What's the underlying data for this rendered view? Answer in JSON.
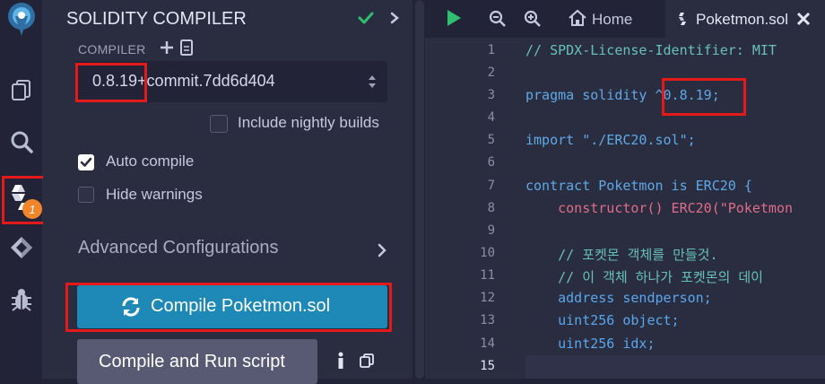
{
  "panel": {
    "title": "SOLIDITY COMPILER",
    "compiler_label": "COMPILER",
    "compiler_version": "0.8.19+commit.7dd6d404",
    "nightly_label": "Include nightly builds",
    "auto_compile_label": "Auto compile",
    "hide_warnings_label": "Hide warnings",
    "advanced_label": "Advanced Configurations",
    "compile_button": "Compile Poketmon.sol",
    "compile_run_button": "Compile and Run script",
    "auto_compile_checked": true,
    "hide_warnings_checked": false,
    "nightly_checked": false
  },
  "iconbar": {
    "badge": "1"
  },
  "editor": {
    "tab_home": "Home",
    "tab_active": "Poketmon.sol",
    "line_numbers": [
      "1",
      "2",
      "3",
      "4",
      "5",
      "6",
      "7",
      "8",
      "9",
      "10",
      "11",
      "12",
      "13",
      "14",
      "15"
    ],
    "lines": [
      "// SPDX-License-Identifier: MIT",
      "",
      "pragma solidity ^0.8.19;",
      "",
      "import \"./ERC20.sol\";",
      "",
      "contract Poketmon is ERC20 {",
      "    constructor() ERC20(\"Poketmon",
      "",
      "    // 포켓몬 객체를 만들것.",
      "    // 이 객체 하나가 포켓몬의 데이",
      "    address sendperson;",
      "    uint256 object;",
      "    uint256 idx;",
      ""
    ]
  },
  "colors": {
    "accent_blue": "#1e88b6",
    "highlight_red": "#e41a1a",
    "badge_orange": "#f0852a",
    "check_green": "#2fbf71"
  }
}
